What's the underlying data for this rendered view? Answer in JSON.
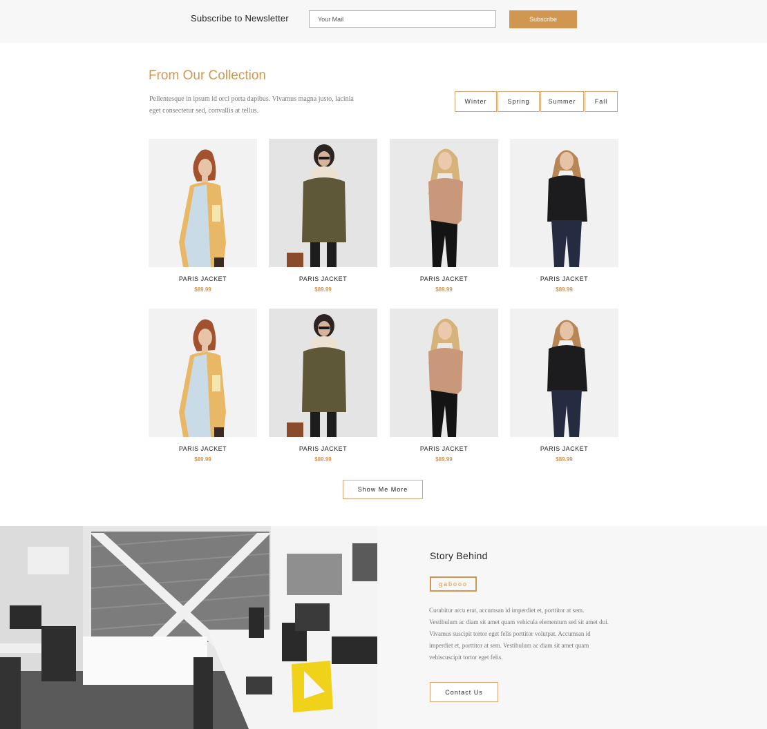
{
  "newsletter": {
    "label": "Subscribe to Newsletter",
    "input_placeholder": "Your Mail",
    "button_label": "Subscribe"
  },
  "collection": {
    "title": "From Our Collection",
    "description": "Pellentesque in ipsum id orci porta dapibus. Vivamus magna justo, lacinia eget consectetur sed, convallis at tellus.",
    "seasons": [
      "Winter",
      "Spring",
      "Summer",
      "Fall"
    ],
    "products": [
      {
        "name": "PARIS JACKET",
        "price": "$89.99",
        "style": "color-block-shirt"
      },
      {
        "name": "PARIS JACKET",
        "price": "$89.99",
        "style": "olive-coat-scarf"
      },
      {
        "name": "PARIS JACKET",
        "price": "$89.99",
        "style": "beige-tee-leather-pants"
      },
      {
        "name": "PARIS JACKET",
        "price": "$89.99",
        "style": "black-shirt-jeans"
      },
      {
        "name": "PARIS JACKET",
        "price": "$89.99",
        "style": "color-block-shirt"
      },
      {
        "name": "PARIS JACKET",
        "price": "$89.99",
        "style": "olive-coat-scarf"
      },
      {
        "name": "PARIS JACKET",
        "price": "$89.99",
        "style": "beige-tee-leather-pants"
      },
      {
        "name": "PARIS JACKET",
        "price": "$89.99",
        "style": "black-shirt-jeans"
      }
    ],
    "show_more_label": "Show Me More"
  },
  "story": {
    "title": "Story Behind",
    "brand": "gabooo",
    "text": "Curabitur arcu erat, accumsan id imperdiet et, porttitor at sem. Vestibulum ac diam sit amet quam vehicula elementum sed sit amet dui. Vivamus suscipit tortor eget felis porttitor volutpat. Accumsan id imperdiet et, porttitor at sem. Vestibulum ac diam sit amet quam vehiscuscipit tortor eget felis.",
    "contact_label": "Contact Us"
  },
  "colors": {
    "accent": "#d1964f",
    "accent_border": "#d9a774",
    "bar_background": "#f7f7f7",
    "text_dark": "#222222",
    "text_muted": "#777777"
  }
}
